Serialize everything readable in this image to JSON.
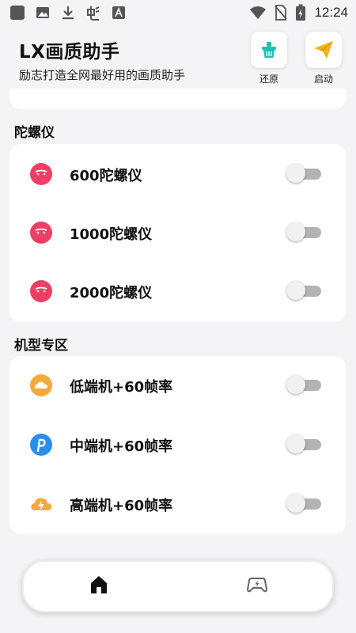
{
  "status_bar": {
    "time": "12:24",
    "icons_left": [
      "image-icon",
      "photo-icon",
      "download-icon",
      "app-icon",
      "a-letter-icon"
    ],
    "icons_right": [
      "wifi-icon",
      "no-sim-icon",
      "battery-icon"
    ]
  },
  "header": {
    "title": "LX画质助手",
    "subtitle": "励志打造全网最好用的画质助手",
    "restore_label": "还原",
    "start_label": "启动",
    "restore_icon": "basket-icon",
    "start_icon": "paper-plane-icon"
  },
  "sections": [
    {
      "title": "陀螺仪",
      "items": [
        {
          "label": "600陀螺仪",
          "icon": "gyro-icon",
          "enabled": false
        },
        {
          "label": "1000陀螺仪",
          "icon": "gyro-icon",
          "enabled": false
        },
        {
          "label": "2000陀螺仪",
          "icon": "gyro-icon",
          "enabled": false
        }
      ]
    },
    {
      "title": "机型专区",
      "items": [
        {
          "label": "低端机+60帧率",
          "icon": "cloud-icon",
          "enabled": false
        },
        {
          "label": "中端机+60帧率",
          "icon": "p-logo-icon",
          "enabled": false
        },
        {
          "label": "高端机+60帧率",
          "icon": "lightning-cloud-icon",
          "enabled": false
        }
      ]
    }
  ],
  "bottom_nav": {
    "items": [
      {
        "name": "home",
        "icon": "home-icon",
        "active": true
      },
      {
        "name": "game",
        "icon": "gamepad-icon",
        "active": false
      }
    ]
  },
  "colors": {
    "background": "#f4f4f6",
    "card": "#ffffff",
    "toggle_off_track": "#b3b3b3",
    "gyro_icon": "#ec3f63",
    "start_icon": "#f6b21b",
    "restore_icon": "#1fc1b5"
  }
}
